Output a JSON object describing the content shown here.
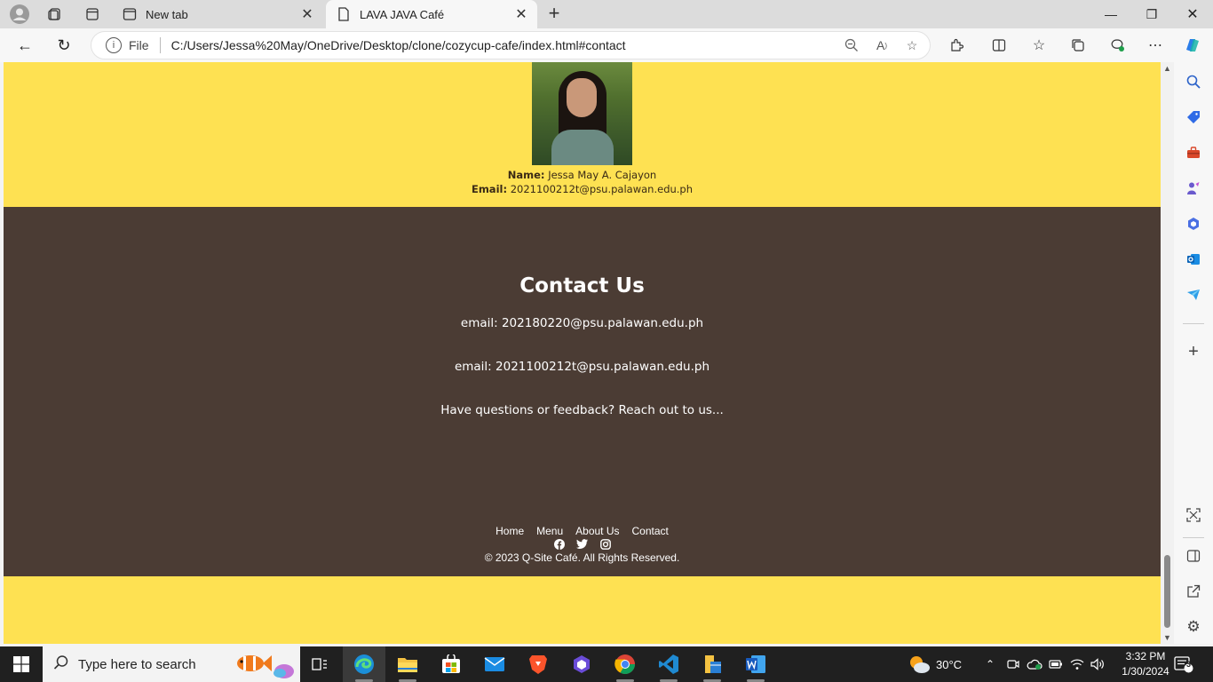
{
  "browser": {
    "tabs": [
      {
        "title": "New tab"
      },
      {
        "title": "LAVA JAVA Café"
      }
    ],
    "address": {
      "file_label": "File",
      "url": "C:/Users/Jessa%20May/OneDrive/Desktop/clone/cozycup-cafe/index.html#contact"
    }
  },
  "page": {
    "member": {
      "name_label": "Name:",
      "name_value": "Jessa May A. Cajayon",
      "email_label": "Email:",
      "email_value": "2021100212t@psu.palawan.edu.ph"
    },
    "contact": {
      "title": "Contact Us",
      "email1": "email: 202180220@psu.palawan.edu.ph",
      "email2": "email: 2021100212t@psu.palawan.edu.ph",
      "tagline": "Have questions or feedback? Reach out to us..."
    },
    "footer": {
      "nav": [
        "Home",
        "Menu",
        "About Us",
        "Contact"
      ],
      "social_icons": [
        "facebook-icon",
        "twitter-icon",
        "instagram-icon"
      ],
      "copyright": "© 2023 Q-Site Café. All Rights Reserved."
    },
    "colors": {
      "yellow": "#fee152",
      "brown": "#4b3c34"
    }
  },
  "taskbar": {
    "search_placeholder": "Type here to search",
    "weather": "30°C",
    "time": "3:32 PM",
    "date": "1/30/2024",
    "notification_count": "3"
  }
}
